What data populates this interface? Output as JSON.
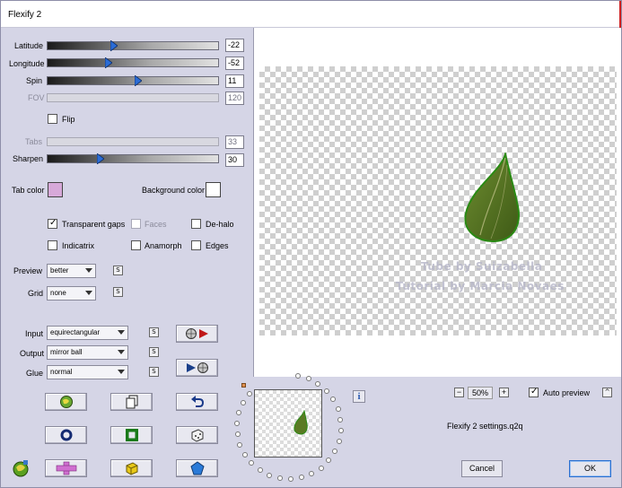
{
  "window": {
    "title": "Flexify 2"
  },
  "sliders": [
    {
      "label": "Latitude",
      "value": "-22",
      "level": 0.4,
      "enabled": true
    },
    {
      "label": "Longitude",
      "value": "-52",
      "level": 0.36,
      "enabled": true
    },
    {
      "label": "Spin",
      "value": "11",
      "level": 0.53,
      "enabled": true
    },
    {
      "label": "FOV",
      "value": "120",
      "enabled": false
    },
    {
      "label": "Tabs",
      "value": "33",
      "enabled": false
    },
    {
      "label": "Sharpen",
      "value": "30",
      "level": 0.31,
      "enabled": true
    }
  ],
  "flip": {
    "label": "Flip",
    "checked": false
  },
  "colors": {
    "tab_color_label": "Tab color",
    "tab_color": "#d7a9d9",
    "background_color_label": "Background color",
    "background_color": "#ffffff",
    "accent": "#2a6fd0"
  },
  "options": {
    "transparent_gaps": {
      "label": "Transparent gaps",
      "checked": true
    },
    "faces": {
      "label": "Faces",
      "checked": false,
      "enabled": false
    },
    "de_halo": {
      "label": "De-halo",
      "checked": false
    },
    "indicatrix": {
      "label": "Indicatrix",
      "checked": false
    },
    "anamorph": {
      "label": "Anamorph",
      "checked": false
    },
    "edges": {
      "label": "Edges",
      "checked": false
    }
  },
  "preview_select": {
    "label": "Preview",
    "value": "better",
    "lock": "S"
  },
  "grid_select": {
    "label": "Grid",
    "value": "none",
    "lock": "S"
  },
  "input_select": {
    "label": "Input",
    "value": "equirectangular",
    "lock": "S"
  },
  "output_select": {
    "label": "Output",
    "value": "mirror ball",
    "lock": "S"
  },
  "glue_select": {
    "label": "Glue",
    "value": "normal",
    "lock": "S"
  },
  "info": {
    "glyph": "i"
  },
  "zoom": {
    "value": "50%",
    "minus": "−",
    "plus": "+"
  },
  "auto_preview": {
    "label": "Auto preview",
    "checked": true,
    "collapse": "^"
  },
  "settings_file": "Flexify 2 settings.q2q",
  "buttons": {
    "cancel": "Cancel",
    "ok": "OK"
  },
  "watermark": {
    "line1": "Tube by Suizabella",
    "line2": "Tutorial by Marcia Novaes"
  },
  "icons": {
    "toolbar_rows": [
      [
        "globe-icon",
        "copy-page-icon",
        "undo-icon"
      ],
      [
        "ring-icon",
        "frame-icon",
        "dice-icon"
      ],
      [
        "cross-shape-icon",
        "cube-icon",
        "pentagon-icon"
      ]
    ]
  }
}
